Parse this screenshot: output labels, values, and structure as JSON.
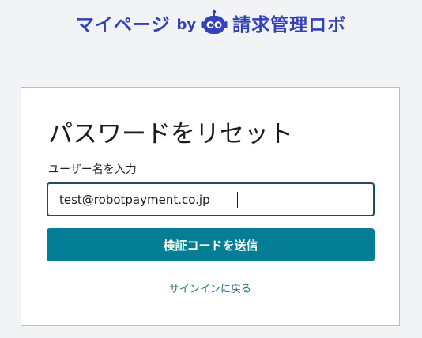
{
  "header": {
    "mypage_label": "マイページ",
    "by_label": "by",
    "brand_name": "請求管理ロボ",
    "brand_color": "#3442b8"
  },
  "reset_form": {
    "title": "パスワードをリセット",
    "username_label": "ユーザー名を入力",
    "username_value": "test@robotpayment.co.jp",
    "submit_label": "検証コードを送信",
    "back_link_label": "サインインに戻る",
    "button_color": "#037e94"
  }
}
